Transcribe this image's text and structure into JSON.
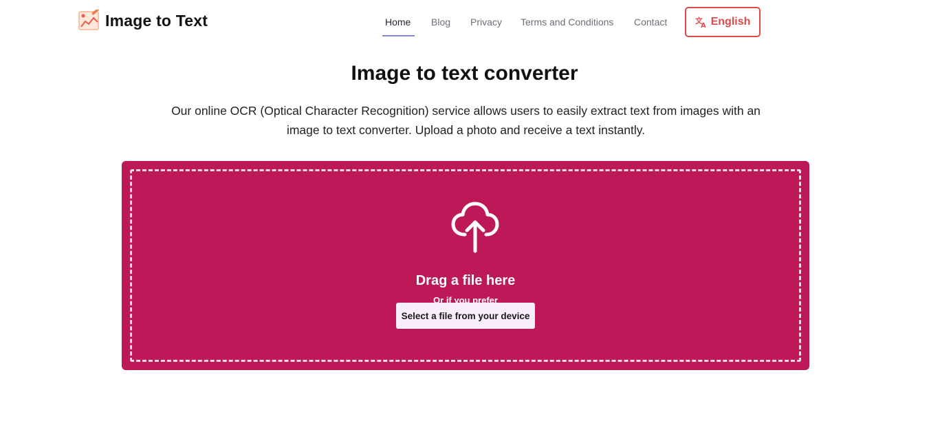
{
  "brand": {
    "name": "Image to Text",
    "logo_icon": "image-chart-icon"
  },
  "nav": {
    "items": [
      {
        "label": "Home",
        "active": true
      },
      {
        "label": "Blog",
        "active": false
      },
      {
        "label": "Privacy",
        "active": false
      },
      {
        "label": "Terms and Conditions",
        "active": false
      },
      {
        "label": "Contact",
        "active": false
      }
    ],
    "language": {
      "label": "English",
      "icon": "translate-icon"
    }
  },
  "hero": {
    "title": "Image to text converter",
    "description": "Our online OCR (Optical Character Recognition) service allows users to easily extract text from images with an image to text converter. Upload a photo and receive a text instantly."
  },
  "upload": {
    "icon": "cloud-upload-icon",
    "drag_label": "Drag a file here",
    "or_label": "Or if you prefer",
    "select_label": "Select a file from your device"
  },
  "colors": {
    "accent": "#bd1858",
    "language_border": "#e04a4a",
    "active_underline": "#7c8ad8",
    "select_button_bg": "#f7eef9"
  }
}
